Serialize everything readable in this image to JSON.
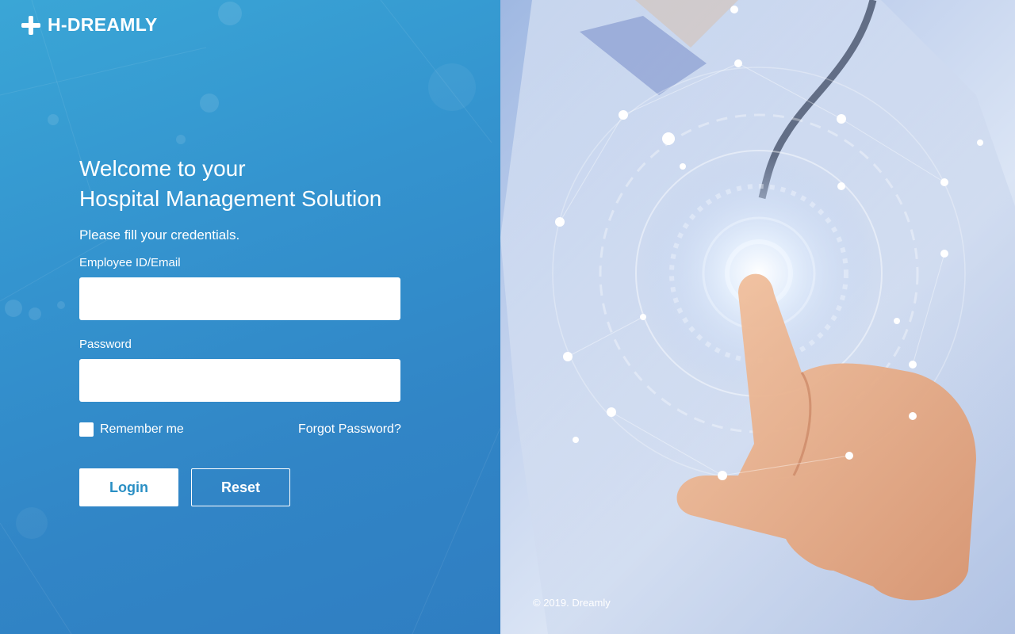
{
  "brand": {
    "name": "H-DREAMLY",
    "icon": "plus-icon"
  },
  "login": {
    "welcome_line1": "Welcome to your",
    "welcome_line2": "Hospital Management Solution",
    "subtitle": "Please fill your credentials.",
    "employee_label": "Employee ID/Email",
    "employee_value": "",
    "password_label": "Password",
    "password_value": "",
    "remember_label": "Remember me",
    "remember_checked": false,
    "forgot_label": "Forgot Password?",
    "login_button": "Login",
    "reset_button": "Reset"
  },
  "footer": {
    "copyright": "© 2019. Dreamly"
  },
  "colors": {
    "left_panel": "#3494cf",
    "login_text": "#2a8fc4",
    "white": "#ffffff"
  }
}
